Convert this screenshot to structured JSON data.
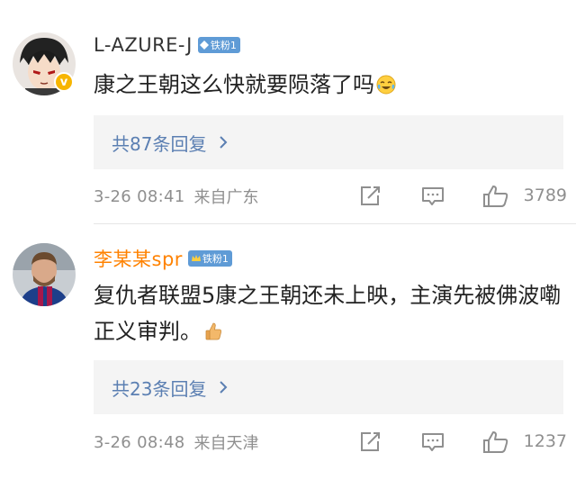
{
  "comments": [
    {
      "username": "L-AZURE-J",
      "fan_badge": "铁粉1",
      "text": "康之王朝这么快就要陨落了吗",
      "emoji_icon": "laughing-tears-emoji",
      "replies_label": "共87条回复",
      "time": "3-26 08:41",
      "source": "来自广东",
      "likes": "3789",
      "verified_mark": "v"
    },
    {
      "username": "李某某spr",
      "fan_badge": "铁粉1",
      "text": "复仇者联盟5康之王朝还未上映，主演先被佛波嘞正义审判。",
      "emoji_icon": "thumbs-up-emoji",
      "replies_label": "共23条回复",
      "time": "3-26 08:48",
      "source": "来自天津",
      "likes": "1237"
    }
  ],
  "colors": {
    "link": "#5b7fb2",
    "meta": "#8f8f8f",
    "username_vip": "#ff8200",
    "badge": "#5f9bd6",
    "reply_bg": "#f4f4f4"
  }
}
